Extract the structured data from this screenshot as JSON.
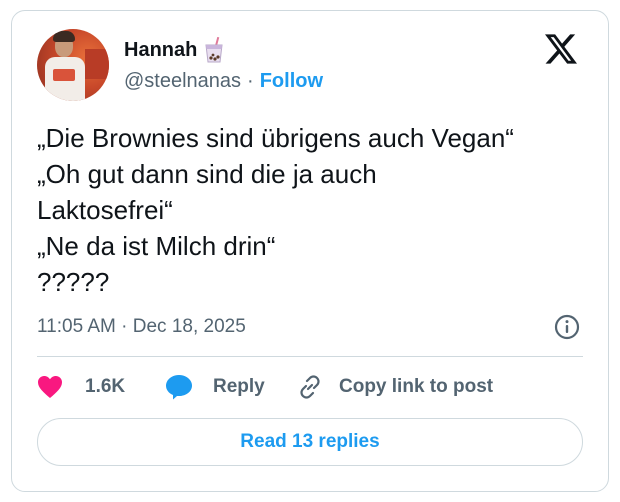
{
  "author": {
    "display_name": "Hannah",
    "name_emoji": "bubble-tea-emoji",
    "handle": "@steelnanas",
    "separator": "·",
    "follow_label": "Follow"
  },
  "tweet": {
    "lines": [
      "„Die Brownies sind übrigens auch Vegan“",
      "„Oh gut dann sind die ja auch",
      "Laktosefrei“",
      "„Ne da ist Milch drin“",
      "?????"
    ],
    "timestamp": "11:05 AM · Dec 18, 2025"
  },
  "actions": {
    "like_count": "1.6K",
    "reply_label": "Reply",
    "copy_link_label": "Copy link to post"
  },
  "read_replies_label": "Read 13 replies",
  "icons": {
    "brand": "x-logo-icon",
    "info": "info-icon",
    "like": "heart-icon",
    "reply": "speech-bubble-icon",
    "copy": "link-icon"
  },
  "colors": {
    "accent": "#1d9bf0",
    "like": "#f91880",
    "text": "#0f1419",
    "muted": "#536471",
    "border": "#cfd9de"
  }
}
